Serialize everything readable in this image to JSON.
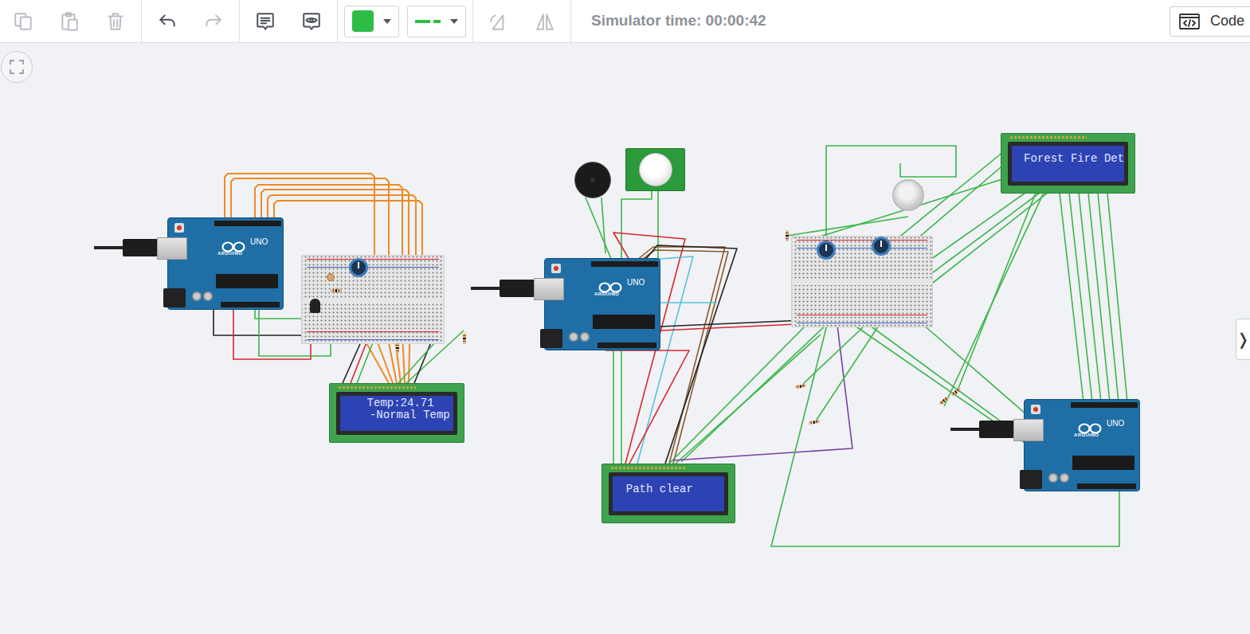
{
  "toolbar": {
    "tools": [
      {
        "kind": "copy",
        "disabled": true
      },
      {
        "kind": "paste",
        "disabled": true
      },
      {
        "kind": "delete",
        "disabled": true
      },
      {
        "kind": "undo",
        "disabled": false
      },
      {
        "kind": "redo",
        "disabled": true
      },
      {
        "kind": "notes",
        "disabled": false
      },
      {
        "kind": "view",
        "disabled": false
      },
      {
        "kind": "color",
        "disabled": false,
        "value": "#2dbd46"
      },
      {
        "kind": "linestyle",
        "disabled": false
      },
      {
        "kind": "rotate",
        "disabled": true
      },
      {
        "kind": "flip",
        "disabled": true
      }
    ],
    "simulator_time": "Simulator time: 00:00:42",
    "code_button": "Code"
  },
  "boards": [
    {
      "brand": "ARDUINO",
      "model": "UNO"
    },
    {
      "brand": "ARDUINO",
      "model": "UNO"
    },
    {
      "brand": "ARDUINO",
      "model": "UNO"
    }
  ],
  "lcds": [
    {
      "lines": [
        "Temp:24.71",
        "-Normal Temp"
      ]
    },
    {
      "lines": [
        "Path clear"
      ]
    },
    {
      "lines": [
        "Forest Fire Det"
      ]
    }
  ],
  "side_tab": "❭"
}
